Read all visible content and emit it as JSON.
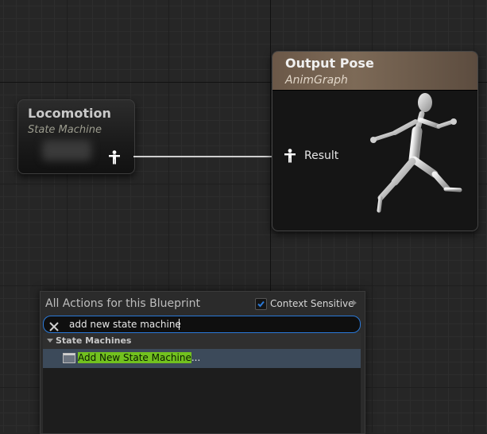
{
  "locomotion_node": {
    "title": "Locomotion",
    "subtitle": "State Machine"
  },
  "output_pose_node": {
    "title": "Output Pose",
    "subtitle": "AnimGraph",
    "pin_label": "Result",
    "preview_icon": "running-mannequin"
  },
  "action_menu": {
    "title": "All Actions for this Blueprint",
    "context_sensitive": {
      "label": "Context Sensitive",
      "checked": true
    },
    "search": {
      "value": "add new state machine",
      "placeholder": ""
    },
    "category": {
      "label": "State Machines"
    },
    "results": [
      {
        "highlight": "Add New State Machine",
        "suffix": "...",
        "icon": "state-machine-icon"
      }
    ]
  },
  "colors": {
    "wire": "#cfcfcf",
    "search_border": "#2a79d8",
    "match_highlight": "#72c11f",
    "output_header": "#7d6a57"
  }
}
